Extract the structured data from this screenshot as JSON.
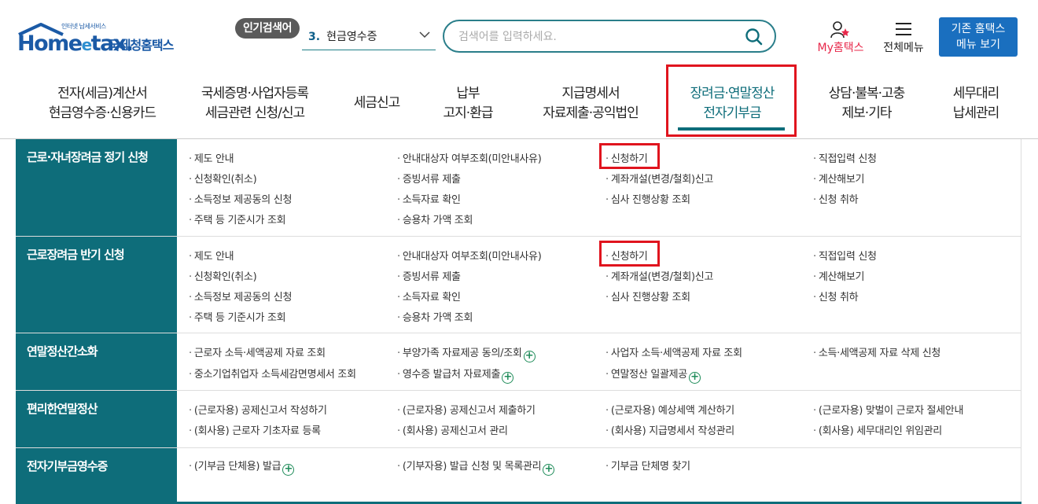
{
  "header": {
    "logo_tag": "인터넷 납세서비스",
    "logo_main": "Home",
    "logo_e": "e",
    "logo_tax": "tax.",
    "logo_sub": "국세청홈택스",
    "popular_badge": "인기검색어",
    "popular_rank": "3.",
    "popular_term": "현금영수증",
    "search_placeholder": "검색어를 입력하세요.",
    "my_label": "My홈택스",
    "allmenu_label": "전체메뉴",
    "oldmenu_line1": "기존 홈택스",
    "oldmenu_line2": "메뉴 보기"
  },
  "gnb": [
    {
      "l1": "전자(세금)계산서",
      "l2": "현금영수증·신용카드"
    },
    {
      "l1": "국세증명·사업자등록",
      "l2": "세금관련 신청/신고"
    },
    {
      "l1": "세금신고",
      "l2": ""
    },
    {
      "l1": "납부",
      "l2": "고지·환급"
    },
    {
      "l1": "지급명세서",
      "l2": "자료제출·공익법인"
    },
    {
      "l1": "장려금·연말정산",
      "l2": "전자기부금"
    },
    {
      "l1": "상담·불복·고충",
      "l2": "제보·기타"
    },
    {
      "l1": "세무대리",
      "l2": "납세관리"
    }
  ],
  "sections": [
    {
      "title": "근로·자녀장려금 정기 신청",
      "cols": [
        [
          "제도 안내",
          "신청확인(취소)",
          "소득정보 제공동의 신청",
          "주택 등 기준시가 조회"
        ],
        [
          "안내대상자 여부조회(미안내사유)",
          "증빙서류 제출",
          "소득자료 확인",
          "승용차 가액 조회"
        ],
        [
          "신청하기",
          "계좌개설(변경/철회)신고",
          "심사 진행상황 조회"
        ],
        [
          "직접입력 신청",
          "계산해보기",
          "신청 취하"
        ]
      ]
    },
    {
      "title": "근로장려금 반기 신청",
      "cols": [
        [
          "제도 안내",
          "신청확인(취소)",
          "소득정보 제공동의 신청",
          "주택 등 기준시가 조회"
        ],
        [
          "안내대상자 여부조회(미안내사유)",
          "증빙서류 제출",
          "소득자료 확인",
          "승용차 가액 조회"
        ],
        [
          "신청하기",
          "계좌개설(변경/철회)신고",
          "심사 진행상황 조회"
        ],
        [
          "직접입력 신청",
          "계산해보기",
          "신청 취하"
        ]
      ]
    },
    {
      "title": "연말정산간소화",
      "cols": [
        [
          "근로자 소득·세액공제 자료 조회",
          "중소기업취업자 소득세감면명세서 조회"
        ],
        [
          "부양가족 자료제공 동의/조회",
          "영수증 발급처 자료제출"
        ],
        [
          "사업자 소득·세액공제 자료 조회",
          "연말정산 일괄제공"
        ],
        [
          "소득·세액공제 자료 삭제 신청"
        ]
      ]
    },
    {
      "title": "편리한연말정산",
      "cols": [
        [
          "(근로자용) 공제신고서 작성하기",
          "(회사용) 근로자 기초자료 등록"
        ],
        [
          "(근로자용) 공제신고서 제출하기",
          "(회사용) 공제신고서 관리"
        ],
        [
          "(근로자용) 예상세액 계산하기",
          "(회사용) 지급명세서 작성관리"
        ],
        [
          "(근로자용) 맞벌이 근로자 절세안내",
          "(회사용) 세무대리인 위임관리"
        ]
      ]
    },
    {
      "title": "전자기부금영수증",
      "cols": [
        [
          "(기부금 단체용) 발급"
        ],
        [
          "(기부자용) 발급 신청 및 목록관리"
        ],
        [
          "기부금 단체명 찾기"
        ],
        []
      ]
    }
  ],
  "plus_symbol": "+"
}
